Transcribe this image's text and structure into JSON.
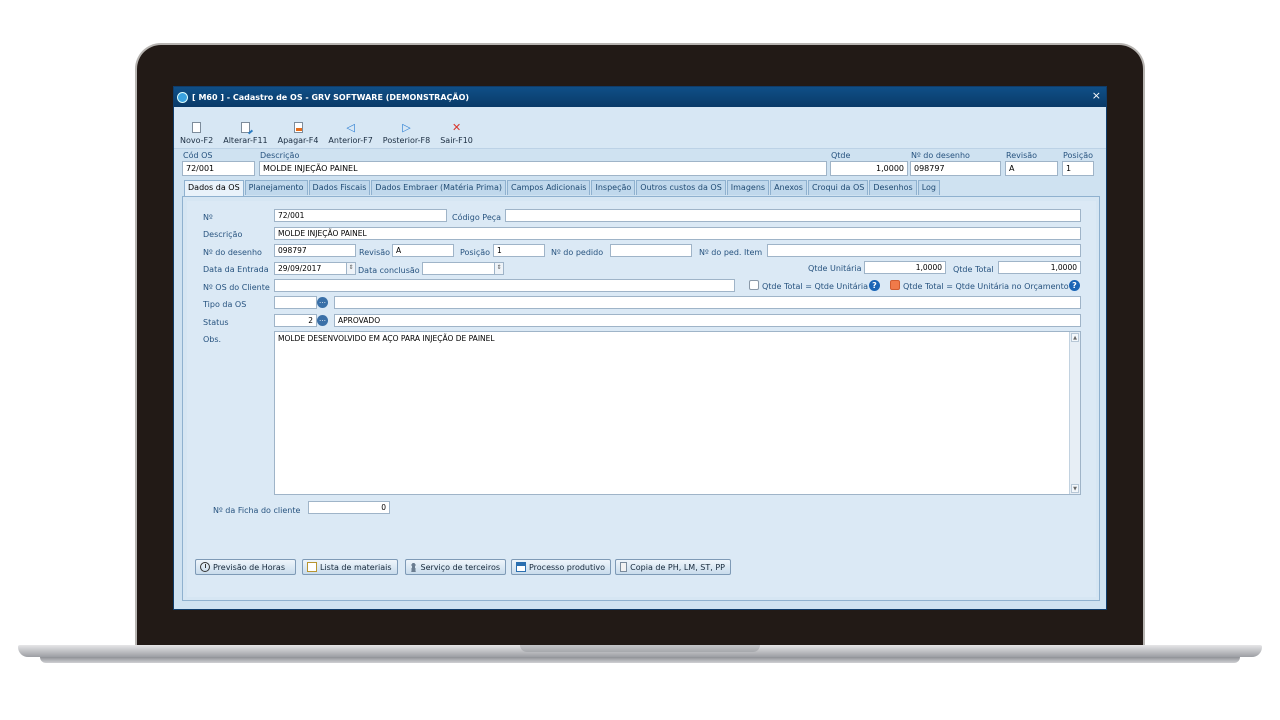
{
  "window": {
    "title": "[ M60 ] - Cadastro de OS - GRV SOFTWARE (DEMONSTRAÇÃO)",
    "close_glyph": "×"
  },
  "toolbar": {
    "buttons": [
      {
        "label": "Novo-F2",
        "icon": "new-document-icon"
      },
      {
        "label": "Alterar-F11",
        "icon": "edit-document-icon"
      },
      {
        "label": "Apagar-F4",
        "icon": "delete-document-icon"
      },
      {
        "label": "Anterior-F7",
        "icon": "arrow-left-icon"
      },
      {
        "label": "Posterior-F8",
        "icon": "arrow-right-icon"
      },
      {
        "label": "Sair-F10",
        "icon": "close-red-x-icon"
      }
    ]
  },
  "header": {
    "cod_os_label": "Cód OS",
    "cod_os_value": "72/001",
    "descricao_label": "Descrição",
    "descricao_value": "MOLDE INJEÇÃO PAINEL",
    "qtde_label": "Qtde",
    "qtde_value": "1,0000",
    "desenho_label": "Nº do desenho",
    "desenho_value": "098797",
    "revisao_label": "Revisão",
    "revisao_value": "A",
    "posicao_label": "Posição",
    "posicao_value": "1"
  },
  "tabs": [
    "Dados da OS",
    "Planejamento",
    "Dados Fiscais",
    "Dados Embraer (Matéria Prima)",
    "Campos Adicionais",
    "Inspeção",
    "Outros custos da OS",
    "Imagens",
    "Anexos",
    "Croqui da OS",
    "Desenhos",
    "Log"
  ],
  "form": {
    "numero_label": "Nº",
    "numero_value": "72/001",
    "codigo_peca_label": "Código Peça",
    "codigo_peca_value": "",
    "descricao_label": "Descrição",
    "descricao_value": "MOLDE INJEÇÃO PAINEL",
    "desenho_label": "Nº do desenho",
    "desenho_value": "098797",
    "revisao_label": "Revisão",
    "revisao_value": "A",
    "posicao_label": "Posição",
    "posicao_value": "1",
    "pedido_label": "Nº do pedido",
    "pedido_value": "",
    "ped_item_label": "Nº do ped. Item",
    "ped_item_value": "",
    "data_entrada_label": "Data da Entrada",
    "data_entrada_value": "29/09/2017",
    "data_conclusao_label": "Data conclusão",
    "data_conclusao_value": "",
    "qtde_unitaria_label": "Qtde Unitária",
    "qtde_unitaria_value": "1,0000",
    "qtde_total_label": "Qtde Total",
    "qtde_total_value": "1,0000",
    "os_cliente_label": "Nº OS do Cliente",
    "os_cliente_value": "",
    "check_total_unit_label": "Qtde Total = Qtde Unitária",
    "check_total_orc_label": "Qtde Total = Qtde Unitária no Orçamento",
    "tipo_os_label": "Tipo da OS",
    "tipo_os_code": "",
    "tipo_os_desc": "",
    "status_label": "Status",
    "status_code": "2",
    "status_desc": "APROVADO",
    "obs_label": "Obs.",
    "obs_value": "MOLDE DESENVOLVIDO EM AÇO PARA INJEÇÃO DE PAINEL",
    "ficha_label": "Nº da Ficha do cliente",
    "ficha_value": "0"
  },
  "bottom_buttons": [
    {
      "label": "Previsão de Horas",
      "icon": "clock-icon"
    },
    {
      "label": "Lista de materiais",
      "icon": "list-icon"
    },
    {
      "label": "Serviço de terceiros",
      "icon": "user-icon"
    },
    {
      "label": "Processo produtivo",
      "icon": "calendar-icon"
    },
    {
      "label": "Copia de PH, LM, ST, PP",
      "icon": "copy-icon"
    }
  ]
}
